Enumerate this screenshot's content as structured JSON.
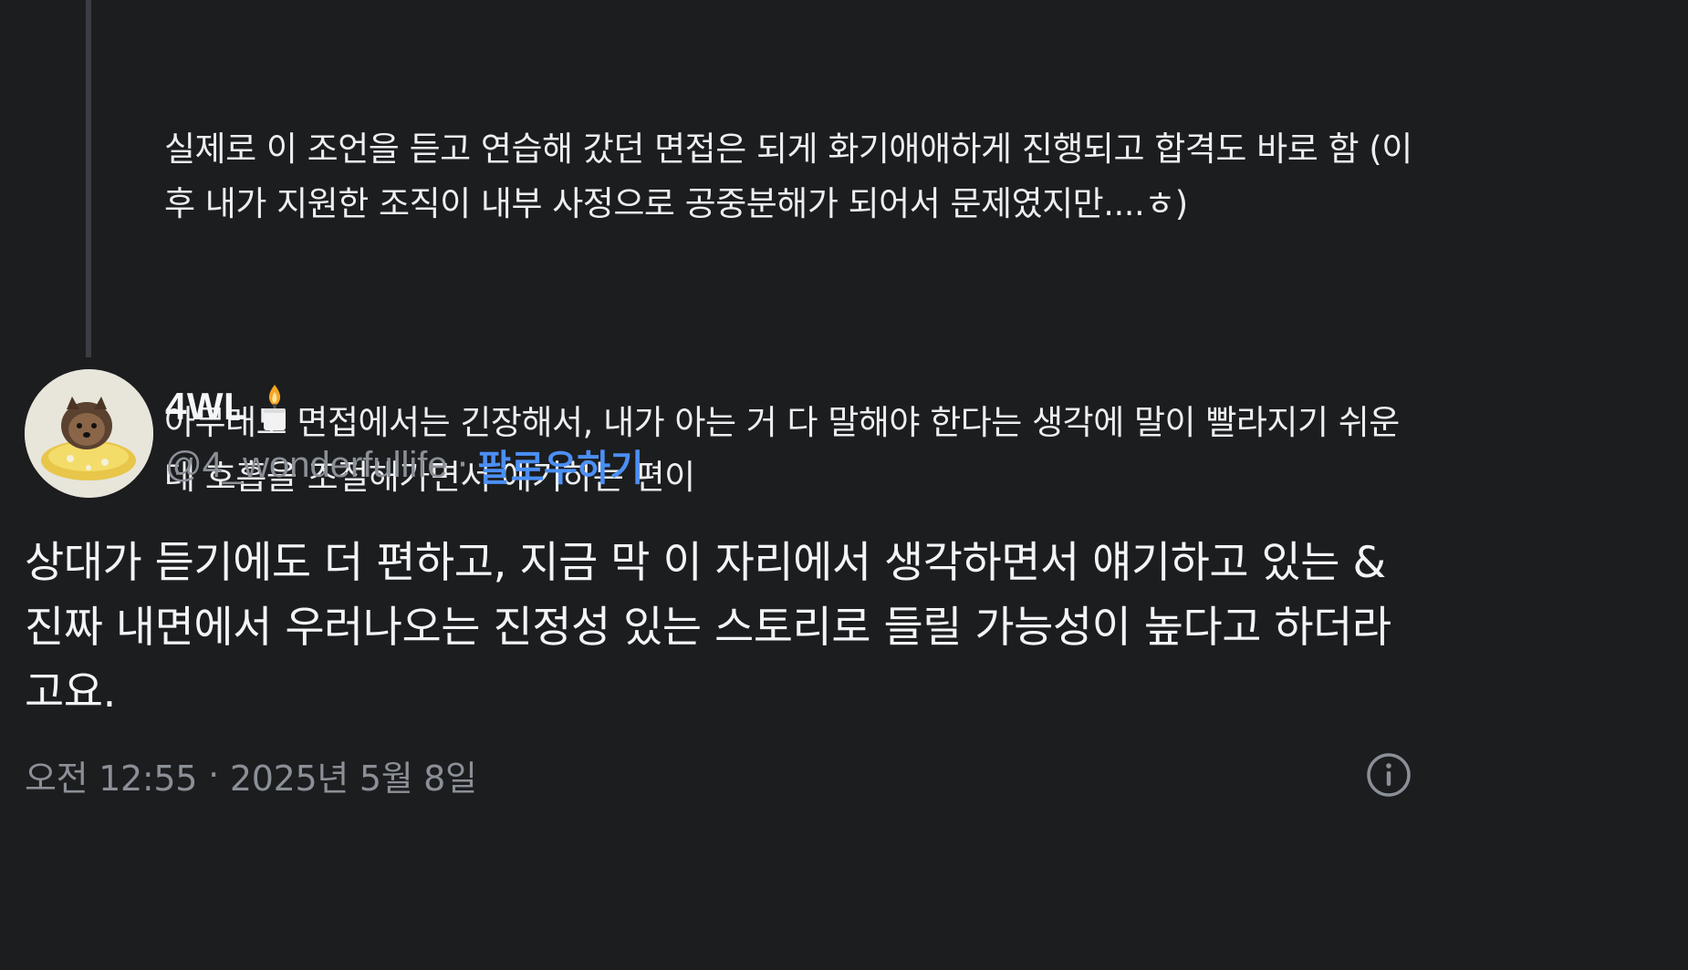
{
  "previous_tweet": {
    "paragraphs": [
      "실제로 이 조언을 듣고 연습해 갔던 면접은 되게 화기애애하게 진행되고 합격도 바로 함 (이후 내가 지원한 조직이 내부 사정으로 공중분해가 되어서 문제였지만....ㅎ)",
      "아무래도 면접에서는 긴장해서, 내가 아는 거 다 말해야 한다는 생각에 말이 빨라지기 쉬운데 호흡을 조절해가면서 얘기하는 편이"
    ]
  },
  "author": {
    "display_name": "4WL",
    "badge_icon": "candle-icon",
    "handle": "@4_wonderfullife",
    "separator": "·",
    "follow_label": "팔로우하기",
    "avatar_icon": "pomeranian-avatar"
  },
  "tweet": {
    "text": "상대가 듣기에도 더 편하고, 지금 막 이 자리에서 생각하면서 얘기하고 있는 & 진짜 내면에서 우러나오는 진정성 있는 스토리로 들릴 가능성이 높다고 하더라고요.",
    "time": "오전 12:55",
    "separator": "·",
    "date": "2025년 5월 8일",
    "info_icon": "info-icon"
  },
  "colors": {
    "background": "#1c1d1f",
    "text": "#f3f4f6",
    "muted": "#8b9097",
    "accent": "#4b8ff5",
    "thread_line": "#3a3d42"
  }
}
